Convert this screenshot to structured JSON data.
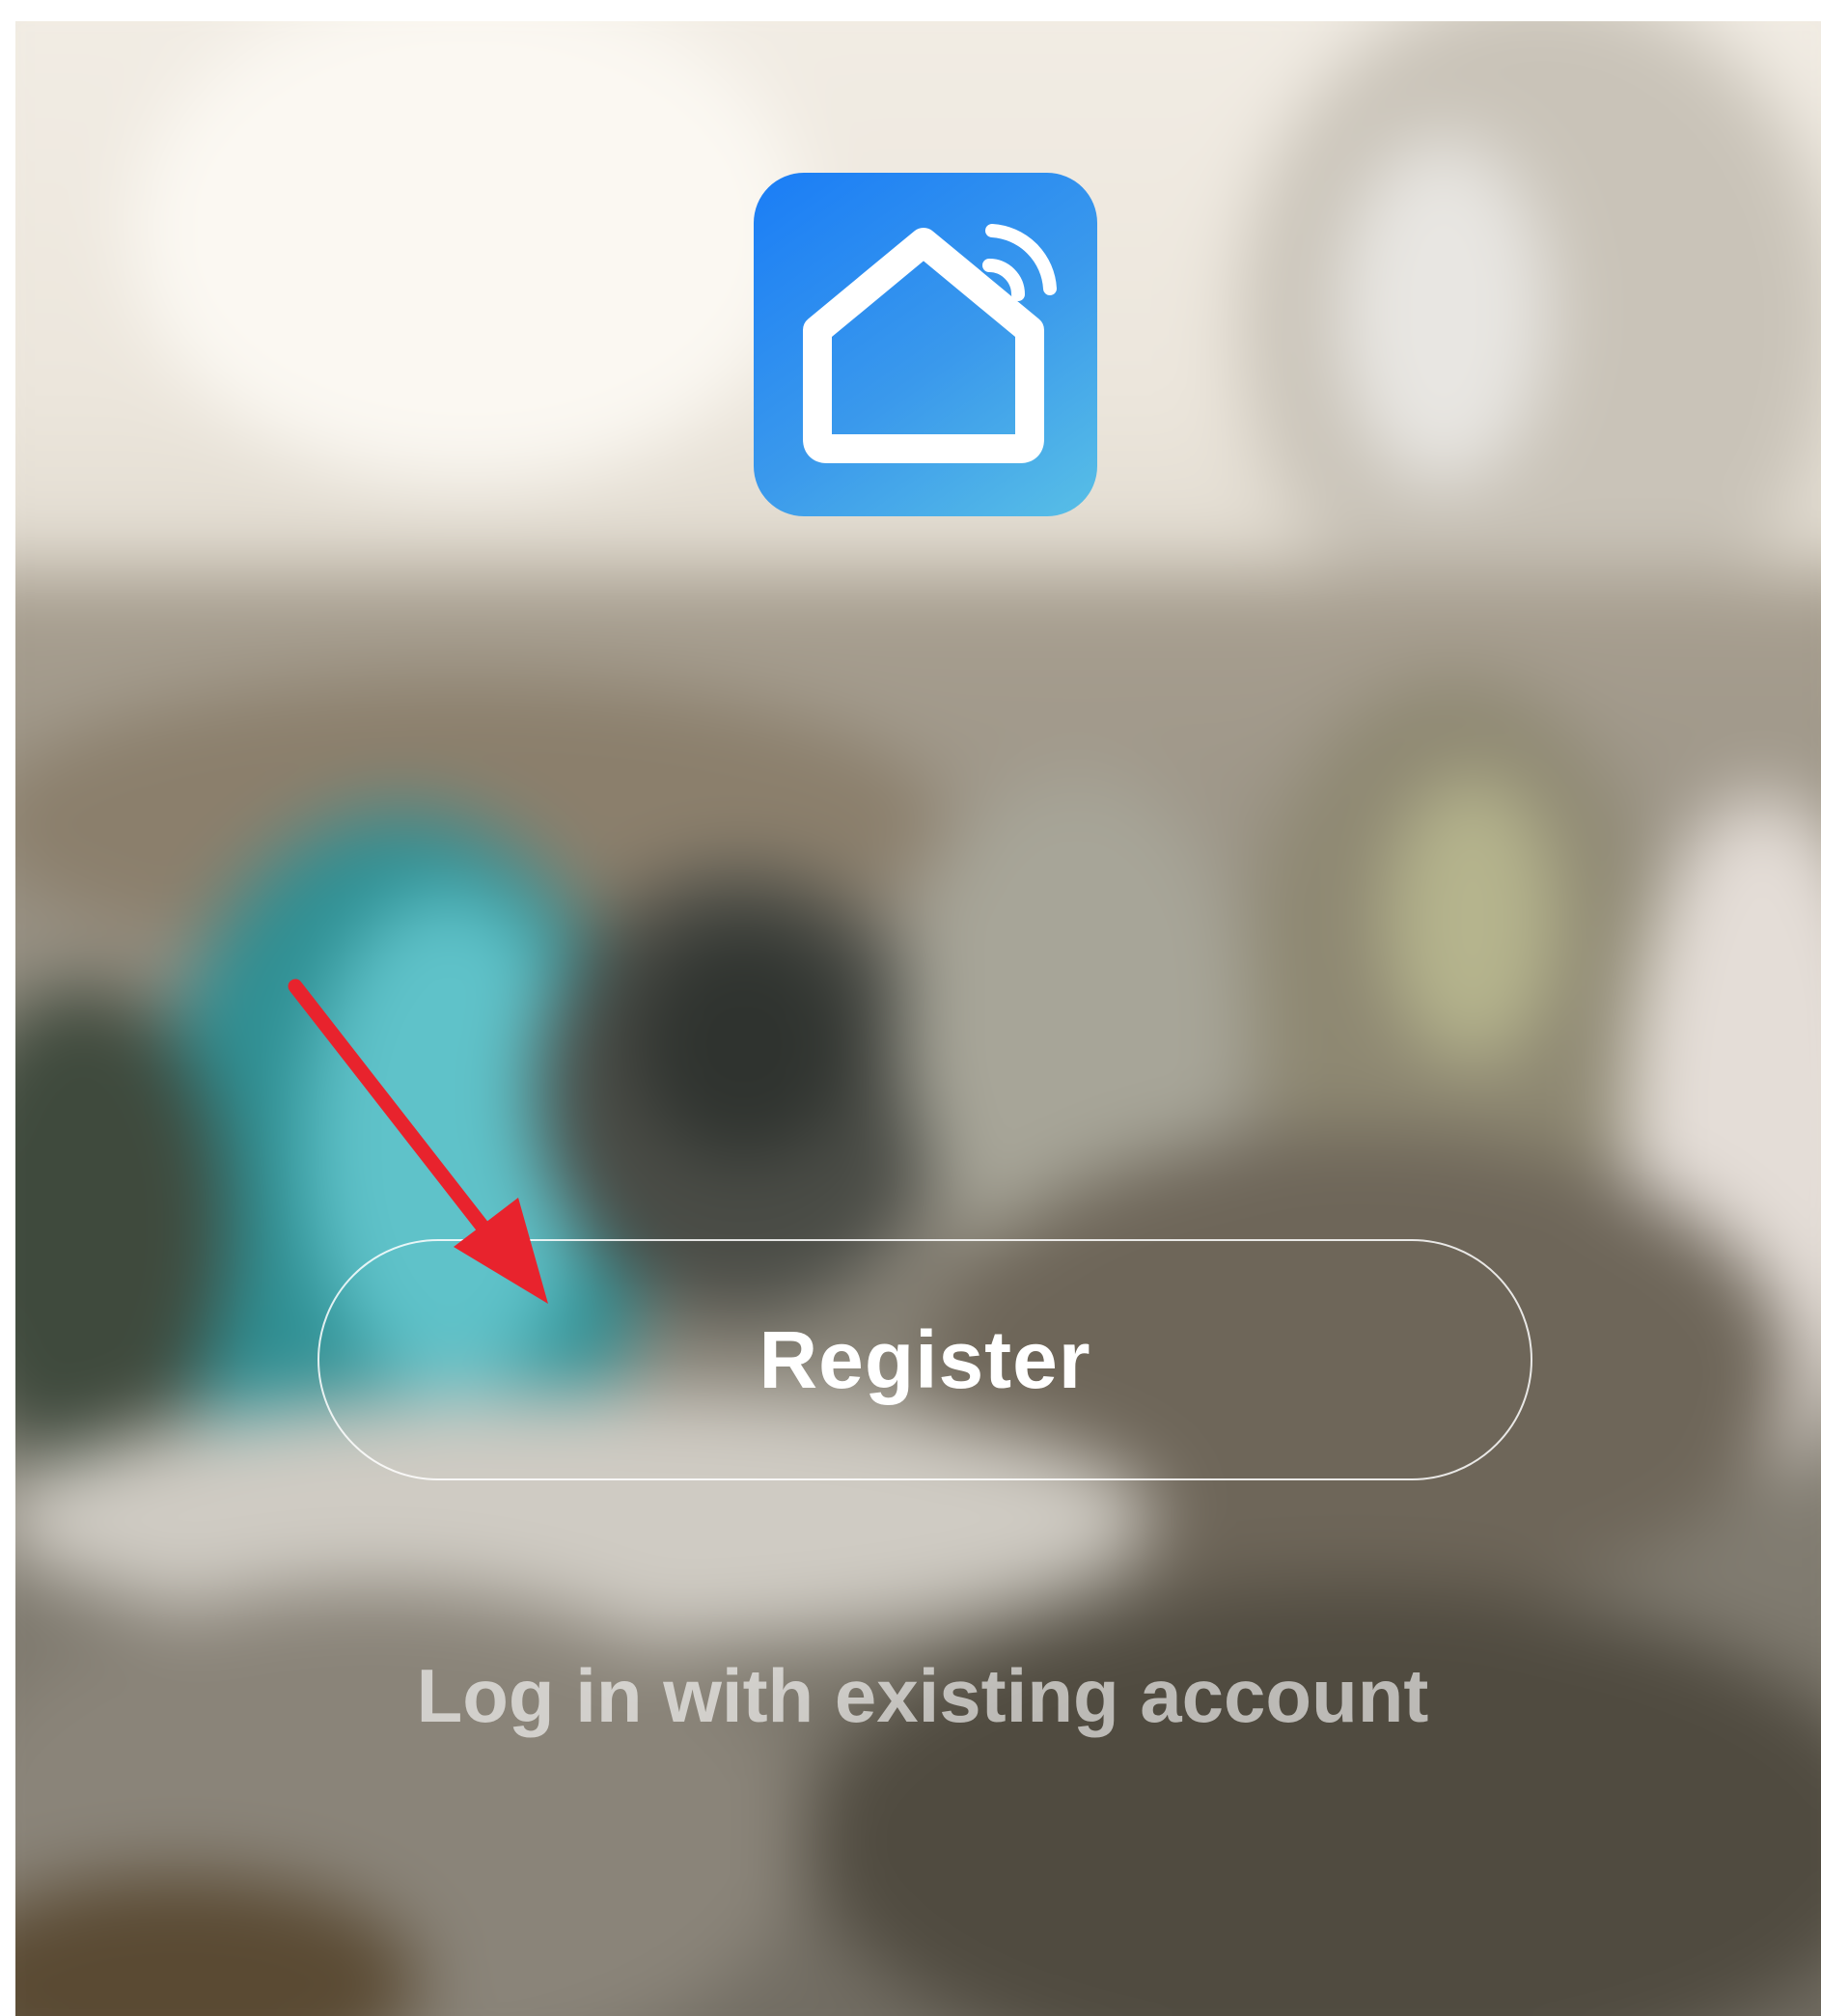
{
  "app": {
    "logo_icon": "smart-home-wifi-icon",
    "logo_gradient": [
      "#1a7df6",
      "#58bfe6"
    ]
  },
  "actions": {
    "register_label": "Register",
    "login_label": "Log in with existing account"
  },
  "annotation": {
    "arrow_color": "#e8232d",
    "arrow_target": "register-button"
  }
}
